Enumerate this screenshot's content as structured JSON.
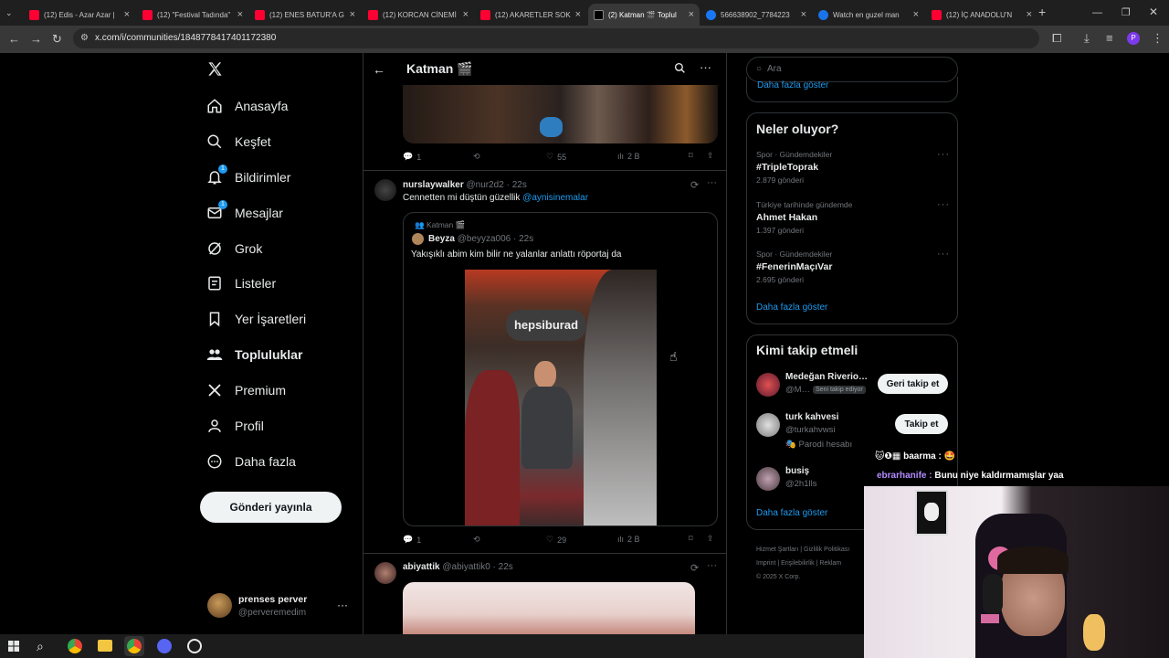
{
  "browser": {
    "tabs": [
      {
        "title": "(12) Edis - Azar Azar |",
        "favicon": "youtube",
        "color": "#ff0033"
      },
      {
        "title": "(12) \"Festival Tadında\"",
        "favicon": "youtube",
        "color": "#ff0033"
      },
      {
        "title": "(12) ENES BATUR'A G",
        "favicon": "youtube",
        "color": "#ff0033"
      },
      {
        "title": "(12) KORCAN CİNEMİ",
        "favicon": "youtube",
        "color": "#ff0033"
      },
      {
        "title": "(12) AKARETLER SOK",
        "favicon": "youtube",
        "color": "#ff0033"
      },
      {
        "title": "(2) Katman 🎬 Toplul",
        "favicon": "x",
        "color": "#000000"
      },
      {
        "title": "566638902_7784223",
        "favicon": "facebook",
        "color": "#1877f2"
      },
      {
        "title": "Watch en guzel man",
        "favicon": "globe",
        "color": "#1a73e8"
      },
      {
        "title": "(12) İÇ ANADOLU'N",
        "favicon": "youtube",
        "color": "#ff0033"
      }
    ],
    "url": "x.com/i/communities/1848778417401172380",
    "profile_initial": "P"
  },
  "sidebar": {
    "nav": [
      {
        "label": "Anasayfa",
        "icon": "home-icon"
      },
      {
        "label": "Keşfet",
        "icon": "search-icon"
      },
      {
        "label": "Bildirimler",
        "icon": "bell-icon",
        "badge": "1"
      },
      {
        "label": "Mesajlar",
        "icon": "mail-icon",
        "badge": "1"
      },
      {
        "label": "Grok",
        "icon": "grok-icon"
      },
      {
        "label": "Listeler",
        "icon": "list-icon"
      },
      {
        "label": "Yer İşaretleri",
        "icon": "bookmark-icon"
      },
      {
        "label": "Topluluklar",
        "icon": "communities-icon"
      },
      {
        "label": "Premium",
        "icon": "x-logo-icon"
      },
      {
        "label": "Profil",
        "icon": "profile-icon"
      },
      {
        "label": "Daha fazla",
        "icon": "more-circle-icon"
      }
    ],
    "post_button": "Gönderi yayınla",
    "account": {
      "name": "prenses perver",
      "handle": "@perveremedim"
    }
  },
  "feed": {
    "header_title": "Katman 🎬",
    "post0": {
      "replies": "1",
      "likes": "55",
      "views": "2 B"
    },
    "post1": {
      "name": "nurslaywalker",
      "handle": "@nur2d2",
      "time": "22s",
      "text": "Cennetten mi düştün güzellik",
      "mention": "@aynisinemalar",
      "quote": {
        "community": "Katman 🎬",
        "name": "Beyza",
        "handle": "@beyyza006",
        "time": "22s",
        "text": "Yakışıklı abim kim bilir ne yalanlar anlattı röportaj da",
        "image_sign": "hepsiburad"
      },
      "replies": "1",
      "likes": "29",
      "views": "2 B"
    },
    "post2": {
      "name": "abiyattik",
      "handle": "@abiyattik0",
      "time": "22s"
    }
  },
  "right": {
    "search_placeholder": "Ara",
    "show_more_top": "Daha fazla göster",
    "trends_title": "Neler oluyor?",
    "trends": [
      {
        "meta": "Spor · Gündemdekiler",
        "name": "#TripleToprak",
        "count": "2.879 gönderi"
      },
      {
        "meta": "Türkiye tarihinde gündemde",
        "name": "Ahmet Hakan",
        "count": "1.397 gönderi"
      },
      {
        "meta": "Spor · Gündemdekiler",
        "name": "#FenerinMaçıVar",
        "count": "2.695 gönderi"
      }
    ],
    "trends_more": "Daha fazla göster",
    "wtf_title": "Kimi takip etmeli",
    "wtf": [
      {
        "name": "Medeğan Riverio…",
        "handle": "@M…",
        "badge": "Seni takip ediyor",
        "button": "Geri takip et"
      },
      {
        "name": "turk kahvesi",
        "handle": "@turkahvwsi",
        "note": "Parodi hesabı",
        "button": "Takip et"
      },
      {
        "name": "busiş",
        "handle": "@2h1lls"
      }
    ],
    "wtf_more": "Daha fazla göster",
    "footer": [
      "Hizmet Şartları",
      "Gizlilik Politikası",
      "Imprint",
      "Erişilebilirlik",
      "Reklam",
      "© 2025 X Corp."
    ]
  },
  "overlay": {
    "chat1_user": "baarma :",
    "chat2_user": "ebrarhanife :",
    "chat2_text": "Bunu niye kaldırmamışlar yaa"
  }
}
